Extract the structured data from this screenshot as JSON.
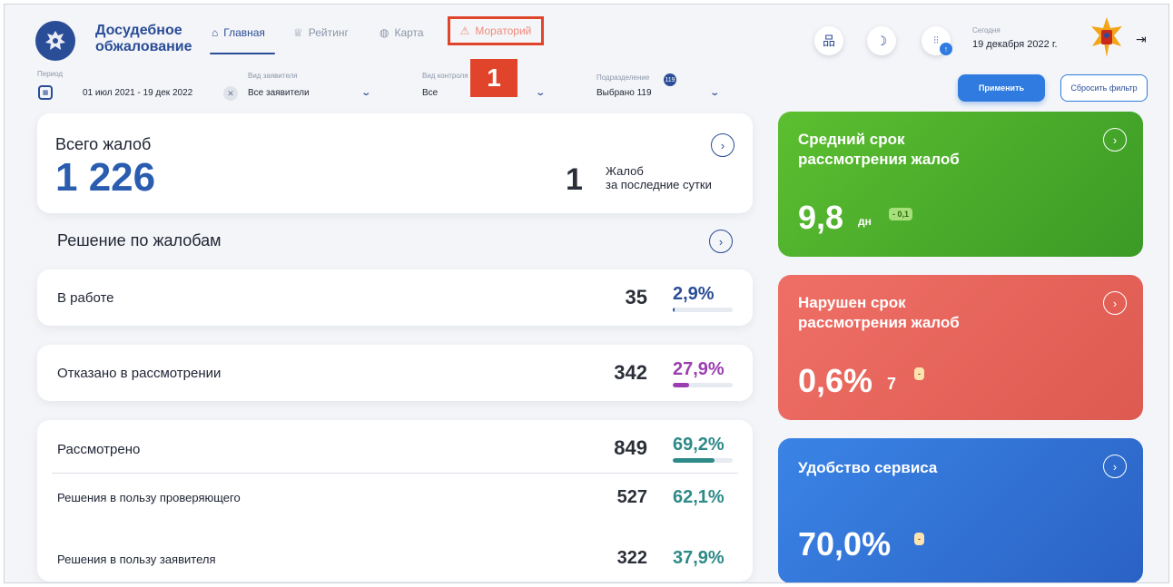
{
  "header": {
    "app_title_line1": "Досудебное",
    "app_title_line2": "обжалование",
    "nav": [
      {
        "label": "Главная",
        "icon": "home-icon"
      },
      {
        "label": "Рейтинг",
        "icon": "trophy-icon"
      },
      {
        "label": "Карта",
        "icon": "globe-icon"
      },
      {
        "label": "Мораторий",
        "icon": "warning-icon"
      }
    ],
    "annotation_badge": "1",
    "today_label": "Сегодня",
    "today_value": "19 декабря 2022 г.",
    "icons": [
      "sitemap-icon",
      "moon-icon",
      "sliders-icon",
      "logout-icon"
    ]
  },
  "filters": {
    "period_label": "Период",
    "period_value": "01 июл 2021  -  19 дек 2022",
    "applicant_label": "Вид заявителя",
    "applicant_value": "Все заявители",
    "control_label": "Вид контроля",
    "control_value": "Все",
    "division_label": "Подразделение",
    "division_badge": "119",
    "division_value": "Выбрано 119",
    "apply_label": "Применить",
    "reset_label": "Сбросить фильтр"
  },
  "summary": {
    "title": "Всего жалоб",
    "total": "1 226",
    "last_day_count": "1",
    "last_day_label1": "Жалоб",
    "last_day_label2": "за последние сутки"
  },
  "decisions": {
    "title": "Решение по жалобам",
    "rows": [
      {
        "label": "В работе",
        "count": "35",
        "percent": "2,9%",
        "fraction": 0.029,
        "color": "#2a4d97"
      },
      {
        "label": "Отказано в рассмотрении",
        "count": "342",
        "percent": "27,9%",
        "fraction": 0.279,
        "color": "#9b3fb0"
      },
      {
        "label": "Рассмотрено",
        "count": "849",
        "percent": "69,2%",
        "fraction": 0.692,
        "color": "#2e8a88"
      }
    ],
    "sub_rows": [
      {
        "label": "Решения в пользу проверяющего",
        "count": "527",
        "percent": "62,1%"
      },
      {
        "label": "Решения в пользу заявителя",
        "count": "322",
        "percent": "37,9%"
      }
    ]
  },
  "tiles": {
    "avg": {
      "title1": "Средний срок",
      "title2": "рассмотрения жалоб",
      "value": "9,8",
      "unit": "дн",
      "delta": "- 0,1",
      "color": "#4caf2a"
    },
    "overdue": {
      "title1": "Нарушен срок",
      "title2": "рассмотрения жалоб",
      "value": "0,6%",
      "count": "7",
      "delta": "-",
      "color": "#e6635a"
    },
    "service": {
      "title": "Удобство сервиса",
      "value": "70,0%",
      "delta": "-",
      "color": "#2f6fd4"
    }
  }
}
